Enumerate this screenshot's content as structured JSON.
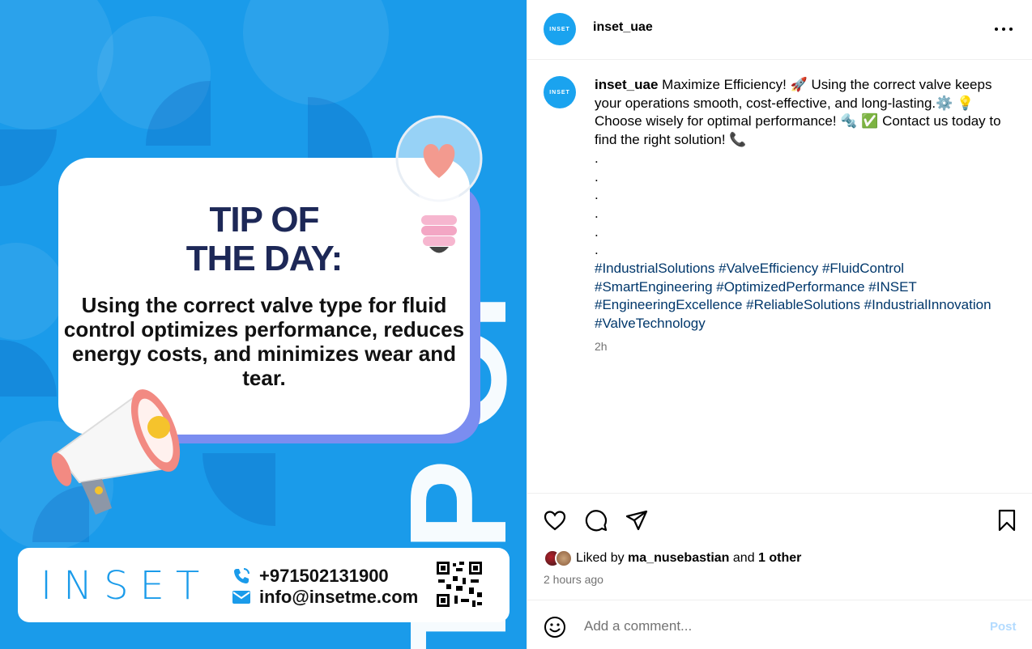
{
  "post_image": {
    "vertical_text": "TIP OF THE DAY",
    "tip_title_line1": "TIP OF",
    "tip_title_line2": "THE DAY:",
    "tip_body": "Using the correct valve type for fluid control optimizes performance, reduces energy costs, and minimizes wear and tear.",
    "brand": "INSET",
    "phone": "+971502131900",
    "email": "info@insetme.com",
    "colors": {
      "background": "#1a9bea",
      "title": "#1d2857",
      "brand": "#1a9bea"
    }
  },
  "header": {
    "avatar_text": "INSET",
    "username": "inset_uae",
    "more_icon": "more-horizontal-icon"
  },
  "caption": {
    "username": "inset_uae",
    "text": "Maximize Efficiency! 🚀 Using the correct valve keeps your operations smooth, cost-effective, and long-lasting.⚙️ 💡 Choose wisely for optimal performance! 🔩 ✅ Contact us today to find the right solution! 📞",
    "dots": [
      ".",
      ".",
      ".",
      ".",
      ".",
      "."
    ],
    "hashtags": "#IndustrialSolutions #ValveEfficiency #FluidControl #SmartEngineering #OptimizedPerformance #INSET #EngineeringExcellence #ReliableSolutions #IndustrialInnovation #ValveTechnology",
    "time": "2h"
  },
  "actions": {
    "like_icon": "heart-icon",
    "comment_icon": "comment-icon",
    "share_icon": "share-icon",
    "save_icon": "bookmark-icon"
  },
  "likes": {
    "prefix": "Liked by",
    "user": "ma_nusebastian",
    "middle": "and",
    "others": "1 other"
  },
  "post_time": "2 hours ago",
  "comment": {
    "placeholder": "Add a comment...",
    "post_label": "Post",
    "emoji_icon": "smiley-icon"
  }
}
